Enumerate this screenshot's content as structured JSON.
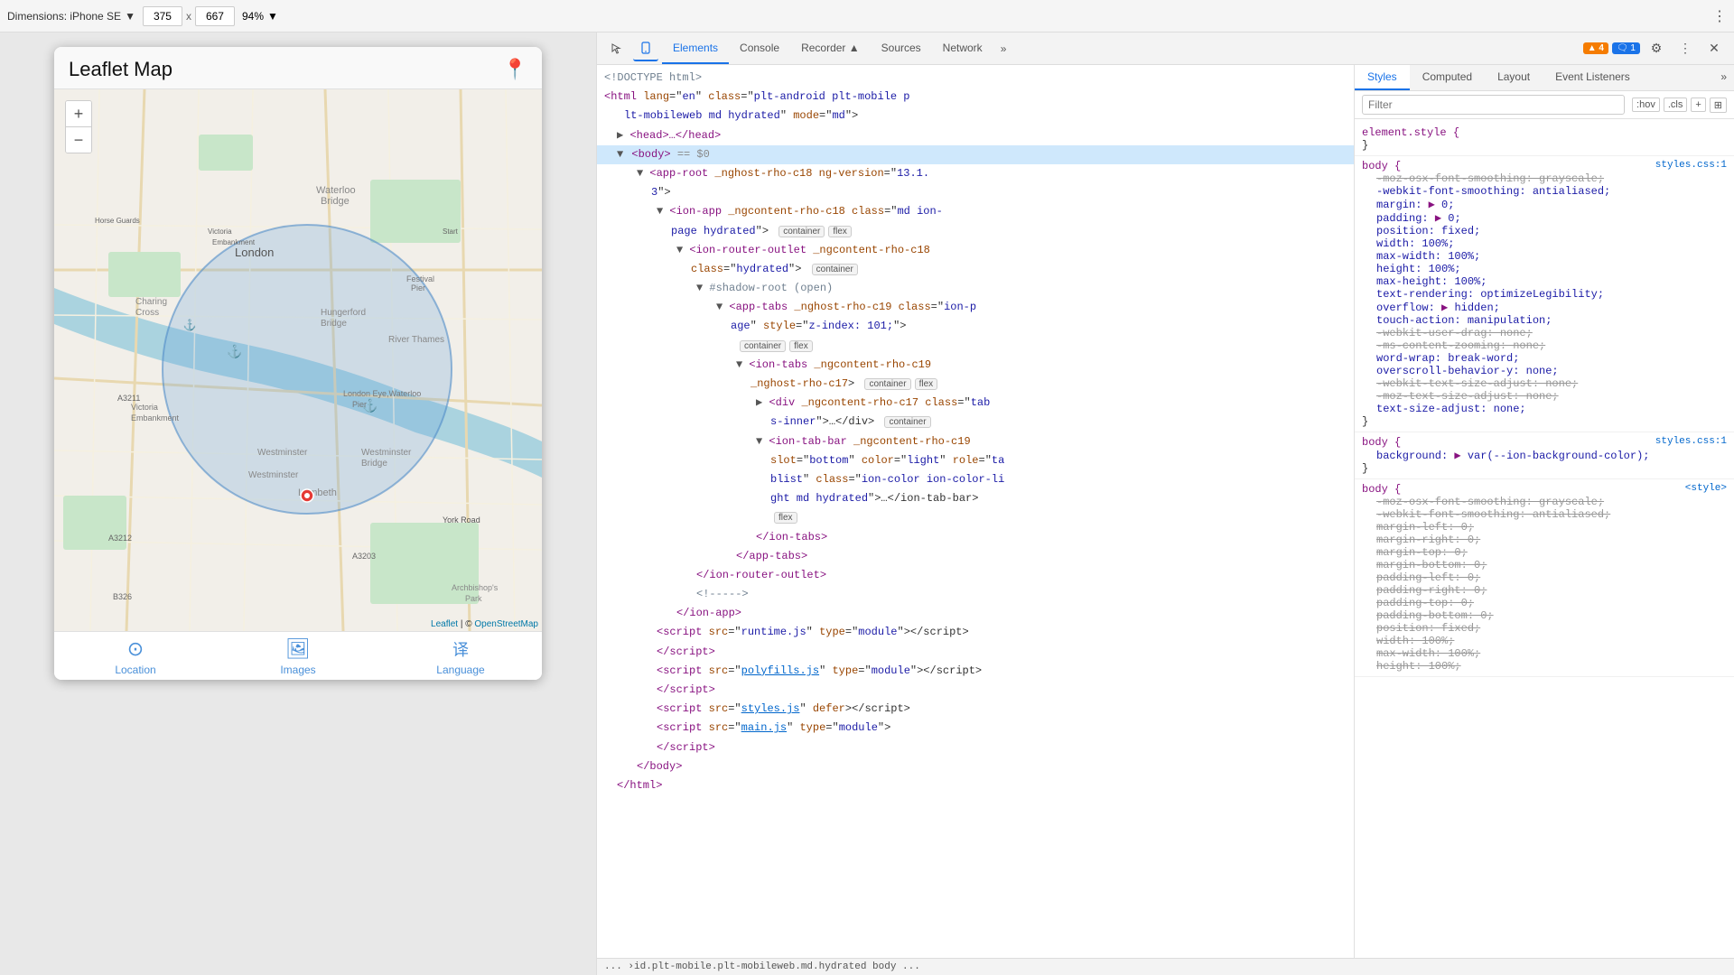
{
  "toolbar": {
    "device_label": "Dimensions: iPhone SE",
    "width": "375",
    "height": "667",
    "zoom": "94%",
    "more_icon": "⋮"
  },
  "phone": {
    "title": "Leaflet Map",
    "pin_icon": "📍",
    "map_attribution": "Leaflet | © OpenStreetMap",
    "zoom_plus": "+",
    "zoom_minus": "−",
    "tabs": [
      {
        "label": "Location",
        "icon": "⊙"
      },
      {
        "label": "Images",
        "icon": "🖼"
      },
      {
        "label": "Language",
        "icon": "翻"
      }
    ]
  },
  "devtools": {
    "tabs": [
      "Elements",
      "Console",
      "Recorder ▲",
      "Sources",
      "Network"
    ],
    "more_tabs": "»",
    "warning_count": "▲ 4",
    "info_count": "🗨 1",
    "gear_icon": "⚙",
    "more_icon": "⋮",
    "close_icon": "✕",
    "cursor_icon": "⬚",
    "device_icon": "📱",
    "styles_tabs": [
      "Styles",
      "Computed",
      "Layout",
      "Event Listeners"
    ],
    "styles_more": "»",
    "filter_placeholder": "Filter",
    "filter_hov": ":hov",
    "filter_cls": ".cls",
    "filter_plus": "+",
    "filter_toggle": "⊞",
    "bottom_bar": "›id.plt-mobile.plt-mobileweb.md.hydrated   body   ...",
    "html_bottom": "... ›id.plt-mobile.plt-mobileweb.md.hydrated   body   ..."
  },
  "html_tree": [
    {
      "indent": 0,
      "content": "<!DOCTYPE html>",
      "type": "comment"
    },
    {
      "indent": 0,
      "content": "<html lang=\"en\" class=\"plt-android plt-mobile p\nlt-mobileweb md hydrated\" mode=\"md\">",
      "type": "tag"
    },
    {
      "indent": 1,
      "content": "▶ <head>…</head>",
      "type": "tag",
      "collapsed": true
    },
    {
      "indent": 1,
      "content": "▼ <body> == $0",
      "type": "tag",
      "selected": true
    },
    {
      "indent": 2,
      "content": "▼ <app-root _nghost-rho-c18 ng-version=\"13.1.\n3\">",
      "type": "tag"
    },
    {
      "indent": 3,
      "content": "▼ <ion-app _ngcontent-rho-c18 class=\"md ion-page hydrated\">",
      "type": "tag",
      "badges": [
        "container",
        "flex"
      ]
    },
    {
      "indent": 4,
      "content": "▼ <ion-router-outlet _ngcontent-rho-c18\nclass=\"hydrated\">",
      "type": "tag",
      "badges": [
        "container"
      ]
    },
    {
      "indent": 5,
      "content": "▼ #shadow-root (open)",
      "type": "comment"
    },
    {
      "indent": 6,
      "content": "▼ <app-tabs _nghost-rho-c19 class=\"ion-p\nage\" style=\"z-index: 101;\">",
      "type": "tag"
    },
    {
      "indent": 7,
      "content": "",
      "badges": [
        "container",
        "flex"
      ]
    },
    {
      "indent": 7,
      "content": "▼ <ion-tabs _ngcontent-rho-c19\n_nghost-rho-c17>",
      "type": "tag",
      "badges": [
        "container",
        "flex"
      ]
    },
    {
      "indent": 8,
      "content": "▶ <div _ngcontent-rho-c17 class=\"tab\ns-inner\">…</div>",
      "type": "tag",
      "badges": [
        "container"
      ]
    },
    {
      "indent": 8,
      "content": "▼ <ion-tab-bar _ngcontent-rho-c19\nslot=\"bottom\" color=\"light\" role=\"ta\nblist\" class=\"ion-color ion-color-li\nght md hydrated\">…</ion-tab-bar>",
      "type": "tag",
      "badges": [
        "flex"
      ]
    },
    {
      "indent": 7,
      "content": "</ion-tabs>",
      "type": "tag"
    },
    {
      "indent": 6,
      "content": "</app-tabs>",
      "type": "tag"
    },
    {
      "indent": 5,
      "content": "</ion-router-outlet>",
      "type": "tag"
    },
    {
      "indent": 5,
      "content": "<!----->",
      "type": "comment"
    },
    {
      "indent": 4,
      "content": "</ion-app>",
      "type": "tag"
    },
    {
      "indent": 3,
      "content": "<script src=\"runtime.js\" type=\"module\"></script>",
      "type": "tag"
    },
    {
      "indent": 3,
      "content": "</script>",
      "type": "tag"
    },
    {
      "indent": 3,
      "content": "<script src=\"polyfills.js\" type=\"module\"></script>",
      "type": "tag"
    },
    {
      "indent": 3,
      "content": "</script>",
      "type": "tag"
    },
    {
      "indent": 3,
      "content": "<script src=\"styles.js\" defer></script>",
      "type": "tag"
    },
    {
      "indent": 3,
      "content": "<script src=\"main.js\" type=\"module\">",
      "type": "tag"
    },
    {
      "indent": 3,
      "content": "</script>",
      "type": "tag"
    },
    {
      "indent": 2,
      "content": "</body>",
      "type": "tag"
    },
    {
      "indent": 1,
      "content": "</html>",
      "type": "tag"
    }
  ],
  "css_rules": [
    {
      "selector": "element.style {",
      "source": "",
      "properties": [
        {
          "name": "}",
          "value": "",
          "strikethrough": false
        }
      ]
    },
    {
      "selector": "body {",
      "source": "styles.css:1",
      "properties": [
        {
          "name": "-moz-osx-font-smoothing:",
          "value": "grayscale;",
          "strikethrough": true
        },
        {
          "name": "-webkit-font-smoothing:",
          "value": "antialiased;",
          "strikethrough": false
        },
        {
          "name": "margin:",
          "value": "▶ 0;",
          "strikethrough": false
        },
        {
          "name": "padding:",
          "value": "▶ 0;",
          "strikethrough": false
        },
        {
          "name": "position:",
          "value": "fixed;",
          "strikethrough": false
        },
        {
          "name": "width:",
          "value": "100%;",
          "strikethrough": false
        },
        {
          "name": "max-width:",
          "value": "100%;",
          "strikethrough": false
        },
        {
          "name": "height:",
          "value": "100%;",
          "strikethrough": false
        },
        {
          "name": "max-height:",
          "value": "100%;",
          "strikethrough": false
        },
        {
          "name": "text-rendering:",
          "value": "optimizeLegibility;",
          "strikethrough": false
        },
        {
          "name": "overflow:",
          "value": "▶ hidden;",
          "strikethrough": false
        },
        {
          "name": "touch-action:",
          "value": "manipulation;",
          "strikethrough": false
        },
        {
          "name": "-webkit-user-drag:",
          "value": "none;",
          "strikethrough": true
        },
        {
          "name": "-ms-content-zooming:",
          "value": "none;",
          "strikethrough": true
        },
        {
          "name": "word-wrap:",
          "value": "break-word;",
          "strikethrough": false
        },
        {
          "name": "overscroll-behavior-y:",
          "value": "none;",
          "strikethrough": false
        },
        {
          "name": "-webkit-text-size-adjust:",
          "value": "none;",
          "strikethrough": true
        },
        {
          "name": "-moz-text-size-adjust:",
          "value": "none;",
          "strikethrough": true
        },
        {
          "name": "text-size-adjust:",
          "value": "none;",
          "strikethrough": false
        },
        {
          "name": "}",
          "value": "",
          "strikethrough": false
        }
      ]
    },
    {
      "selector": "body {",
      "source": "styles.css:1",
      "properties": [
        {
          "name": "background:",
          "value": "▶ var(--ion-background-color);",
          "strikethrough": false
        },
        {
          "name": "}",
          "value": "",
          "strikethrough": false
        }
      ]
    },
    {
      "selector": "body {",
      "source": "<style>",
      "properties": [
        {
          "name": "-moz-osx-font-smoothing:",
          "value": "grayscale;",
          "strikethrough": true
        },
        {
          "name": "-webkit-font-smoothing:",
          "value": "antialiased;",
          "strikethrough": true
        },
        {
          "name": "margin-left:",
          "value": "0;",
          "strikethrough": true
        },
        {
          "name": "margin-right:",
          "value": "0;",
          "strikethrough": true
        },
        {
          "name": "margin-top:",
          "value": "0;",
          "strikethrough": true
        },
        {
          "name": "margin-bottom:",
          "value": "0;",
          "strikethrough": true
        },
        {
          "name": "padding-left:",
          "value": "0;",
          "strikethrough": true
        },
        {
          "name": "padding-right:",
          "value": "0;",
          "strikethrough": true
        },
        {
          "name": "padding-top:",
          "value": "0;",
          "strikethrough": true
        },
        {
          "name": "padding-bottom:",
          "value": "0;",
          "strikethrough": true
        },
        {
          "name": "position:",
          "value": "fixed;",
          "strikethrough": true
        },
        {
          "name": "width:",
          "value": "100%;",
          "strikethrough": true
        },
        {
          "name": "max-width:",
          "value": "100%;",
          "strikethrough": true
        },
        {
          "name": "height:",
          "value": "100%;",
          "strikethrough": true
        }
      ]
    }
  ]
}
